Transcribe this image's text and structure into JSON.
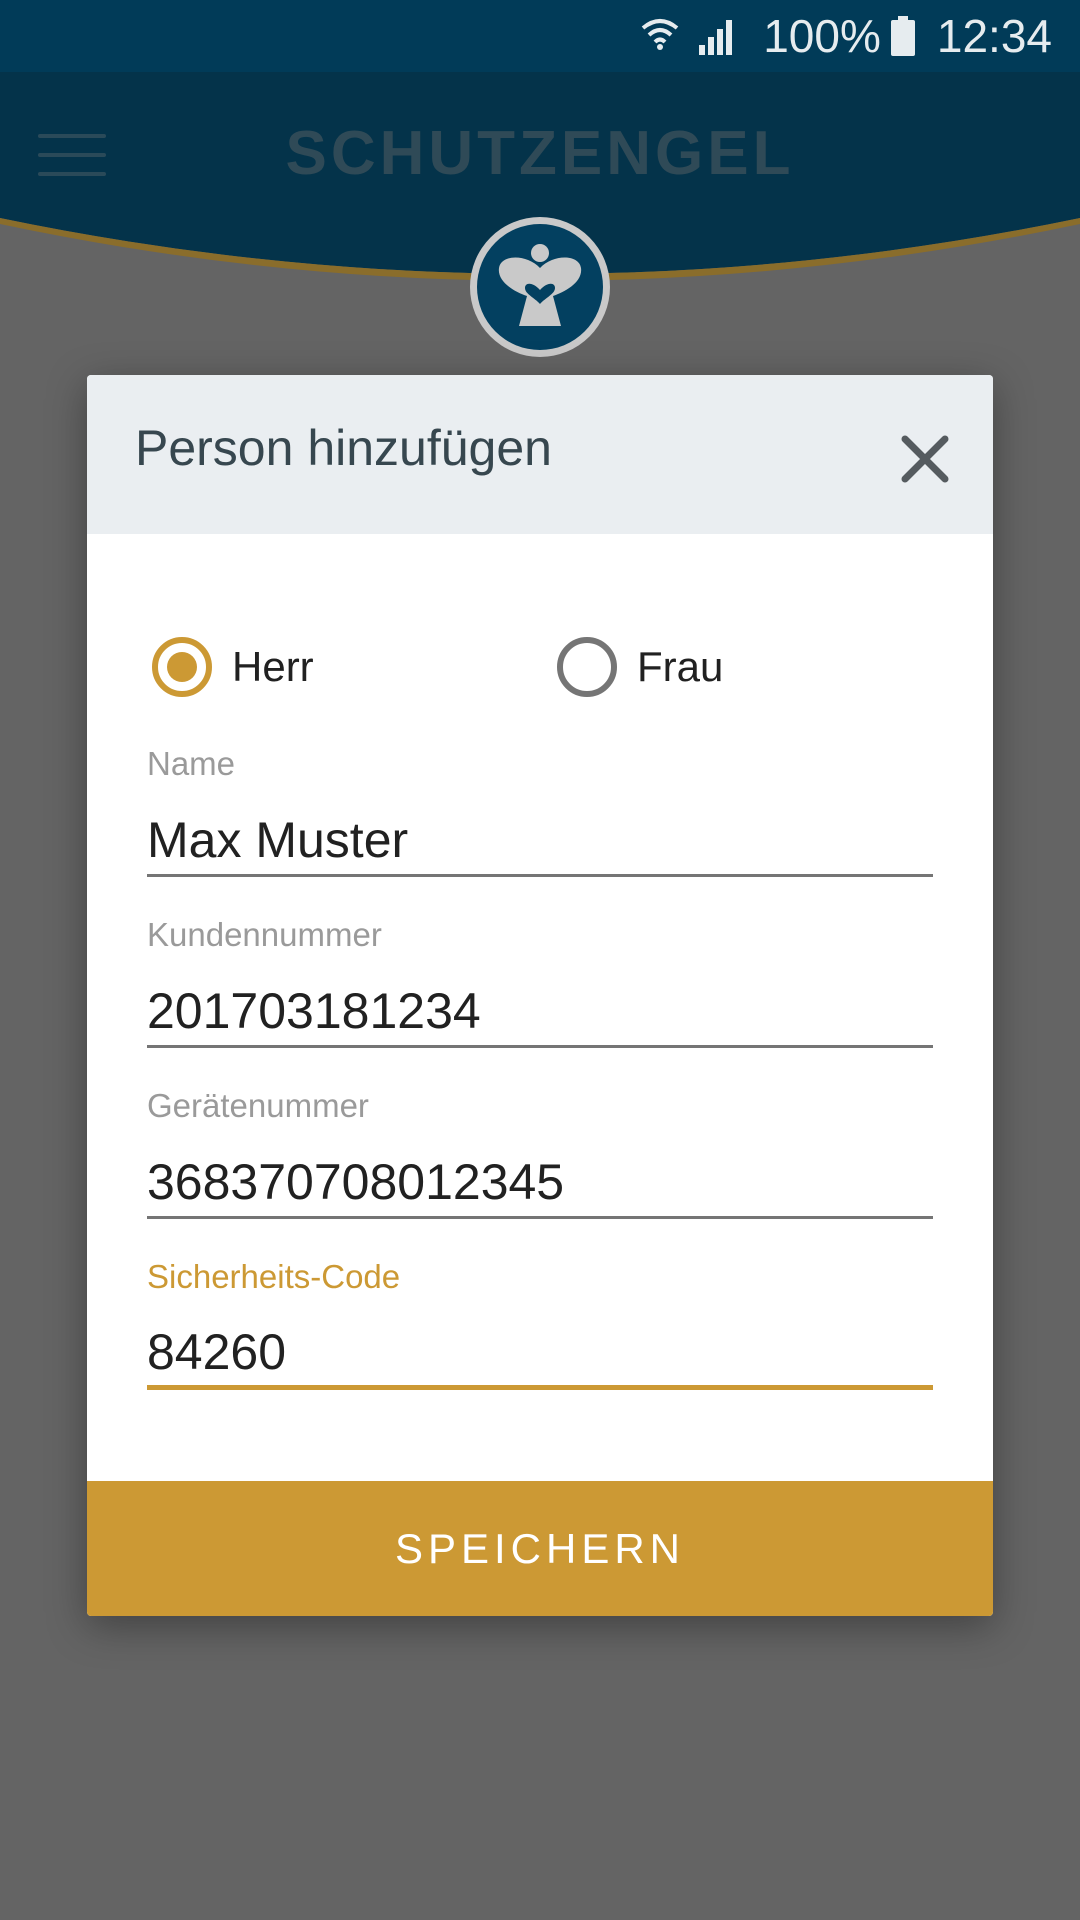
{
  "status_bar": {
    "battery": "100%",
    "time": "12:34",
    "icons": [
      "wifi-icon",
      "signal-icon",
      "battery-icon"
    ]
  },
  "app": {
    "title": "SCHUTZENGEL",
    "logo": "angel-icon",
    "menu_icon": "hamburger-menu-icon"
  },
  "dialog": {
    "title": "Person hinzufügen",
    "close_icon": "close-icon",
    "salutation": {
      "options": [
        {
          "label": "Herr",
          "selected": true
        },
        {
          "label": "Frau",
          "selected": false
        }
      ]
    },
    "fields": {
      "name": {
        "label": "Name",
        "value": "Max Muster"
      },
      "kundennummer": {
        "label": "Kundennummer",
        "value": "201703181234"
      },
      "geraetenummer": {
        "label": "Gerätenummer",
        "value": "368370708012345"
      },
      "sicherheitscode": {
        "label": "Sicherheits-Code",
        "value": "84260"
      }
    },
    "save_label": "SPEICHERN"
  },
  "colors": {
    "accent": "#cc9934",
    "header_blue": "#013b58",
    "overlay": "#646464",
    "dialog_header": "#eaeef1"
  }
}
